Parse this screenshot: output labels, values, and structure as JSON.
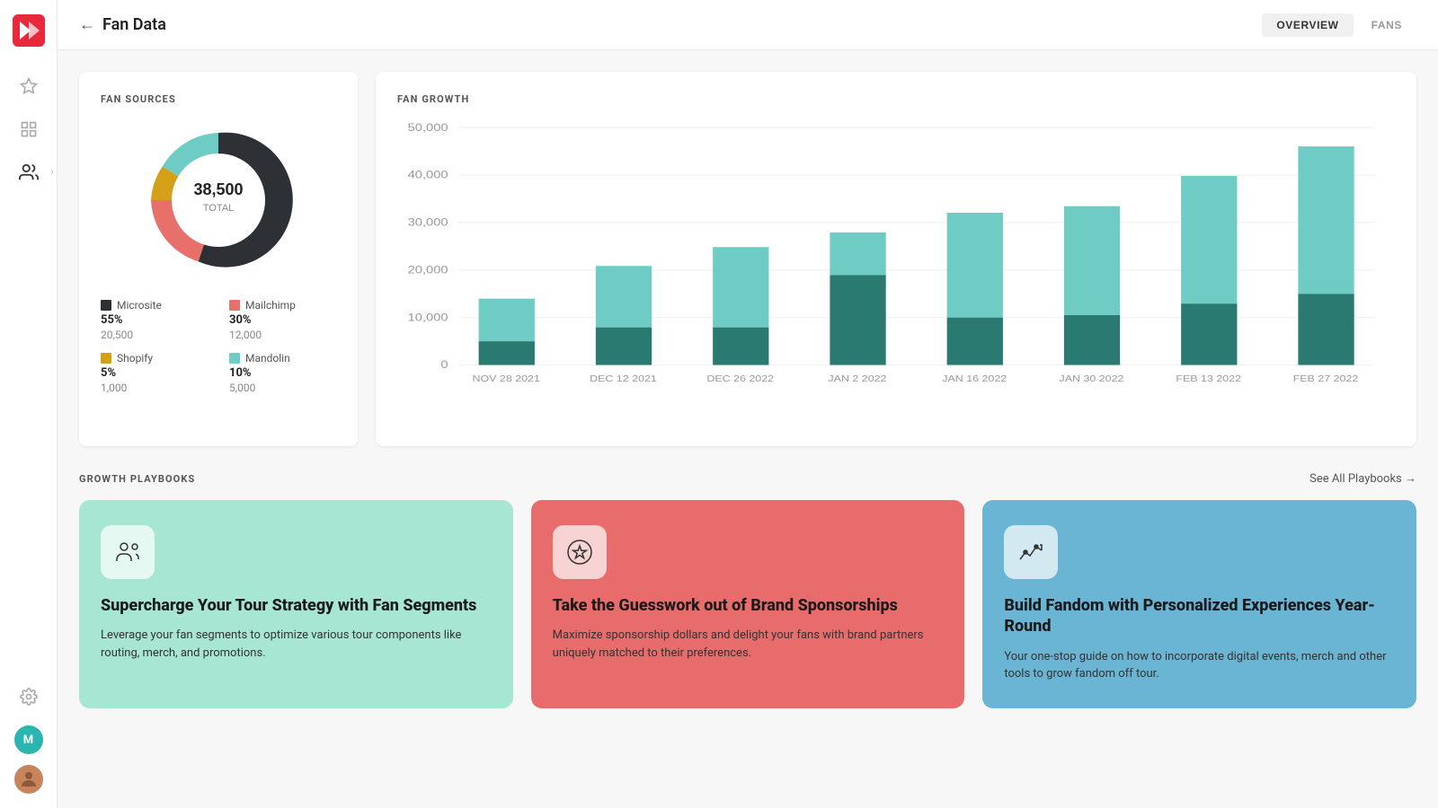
{
  "app": {
    "logo_color": "#e8293b"
  },
  "topbar": {
    "back_label": "←",
    "title": "Fan Data",
    "nav_items": [
      {
        "id": "overview",
        "label": "OVERVIEW",
        "active": true
      },
      {
        "id": "fans",
        "label": "FANS",
        "active": false
      }
    ]
  },
  "sidebar": {
    "icons": [
      {
        "id": "star",
        "symbol": "★",
        "active": false
      },
      {
        "id": "grid",
        "symbol": "▦",
        "active": false
      },
      {
        "id": "users",
        "symbol": "👥",
        "active": true
      }
    ],
    "bottom": {
      "settings_symbol": "⚙",
      "avatar_m_label": "M",
      "avatar_img_label": ""
    }
  },
  "fan_sources": {
    "section_title": "FAN SOURCES",
    "total_label": "TOTAL",
    "total_value": "38,500",
    "donut": {
      "segments": [
        {
          "name": "Microsite",
          "pct": 55,
          "value": 20500,
          "color": "#2d3135",
          "startAngle": 0,
          "endAngle": 198
        },
        {
          "name": "Mailchimp",
          "pct": 30,
          "value": 12000,
          "color": "#e8706a",
          "startAngle": 198,
          "endAngle": 306
        },
        {
          "name": "Shopify",
          "pct": 5,
          "value": 1000,
          "color": "#d4a017",
          "startAngle": 306,
          "endAngle": 324
        },
        {
          "name": "Mandolin",
          "pct": 10,
          "value": 5000,
          "color": "#6eccc4",
          "startAngle": 324,
          "endAngle": 360
        }
      ]
    },
    "legend": [
      {
        "name": "Microsite",
        "pct": "55%",
        "count": "20,500",
        "color": "#2d3135"
      },
      {
        "name": "Mailchimp",
        "pct": "30%",
        "count": "12,000",
        "color": "#e8706a"
      },
      {
        "name": "Shopify",
        "pct": "5%",
        "count": "1,000",
        "color": "#d4a017"
      },
      {
        "name": "Mandolin",
        "pct": "10%",
        "count": "5,000",
        "color": "#6eccc4"
      }
    ]
  },
  "fan_growth": {
    "section_title": "FAN GROWTH",
    "y_labels": [
      "50,000",
      "40,000",
      "30,000",
      "20,000",
      "10,000",
      "0"
    ],
    "x_labels": [
      "NOV 28 2021",
      "DEC 12 2021",
      "DEC 26 2022",
      "JAN 2 2022",
      "JAN 16 2022",
      "JAN 30 2022",
      "FEB 13 2022",
      "FEB 27 2022"
    ],
    "color_dark": "#2a7a72",
    "color_light": "#6eccc4",
    "bars": [
      {
        "label": "NOV 28 2021",
        "dark": 5000,
        "light": 9000
      },
      {
        "label": "DEC 12 2021",
        "dark": 8000,
        "light": 13000
      },
      {
        "label": "DEC 26 2022",
        "dark": 8000,
        "light": 17000
      },
      {
        "label": "JAN 2 2022",
        "dark": 19000,
        "light": 9000
      },
      {
        "label": "JAN 16 2022",
        "dark": 10000,
        "light": 22000
      },
      {
        "label": "JAN 30 2022",
        "dark": 10500,
        "light": 23000
      },
      {
        "label": "FEB 13 2022",
        "dark": 13000,
        "light": 27000
      },
      {
        "label": "FEB 27 2022",
        "dark": 15000,
        "light": 31000
      }
    ],
    "max_value": 50000
  },
  "playbooks": {
    "section_title": "GROWTH PLAYBOOKS",
    "see_all_label": "See All Playbooks →",
    "items": [
      {
        "id": "tour",
        "color_class": "green",
        "icon": "users-group",
        "title": "Supercharge Your Tour Strategy with Fan Segments",
        "description": "Leverage your fan segments to optimize various tour components like routing, merch, and promotions."
      },
      {
        "id": "sponsorships",
        "color_class": "red",
        "icon": "star-circle",
        "title": "Take the Guesswork out of Brand Sponsorships",
        "description": "Maximize sponsorship dollars and delight your fans with brand partners uniquely matched to their preferences."
      },
      {
        "id": "fandom",
        "color_class": "blue",
        "icon": "chart-trend",
        "title": "Build Fandom with Personalized Experiences Year-Round",
        "description": "Your one-stop guide on how to incorporate digital events, merch and other tools to grow fandom off tour."
      }
    ]
  }
}
